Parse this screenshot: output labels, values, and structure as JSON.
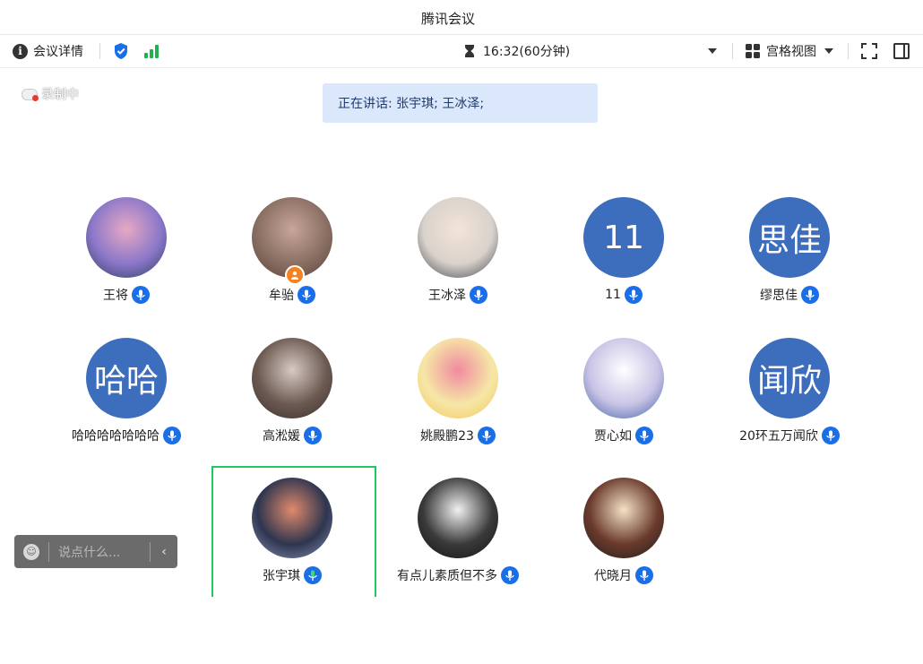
{
  "window": {
    "title": "腾讯会议"
  },
  "toolbar": {
    "details_label": "会议详情",
    "timer": "16:32(60分钟)",
    "view_label": "宫格视图"
  },
  "recording_label": "录制中",
  "speaking_banner": "正在讲话: 张宇琪; 王冰泽;",
  "participants": [
    {
      "name": "王将",
      "avatar_type": "photo",
      "avatar_colors": [
        "#8b77c9",
        "#e7a9c4",
        "#2b3a5e"
      ]
    },
    {
      "name": "牟骀",
      "avatar_type": "photo",
      "host": true,
      "avatar_colors": [
        "#8a6f63",
        "#c9a59a",
        "#5a4038"
      ]
    },
    {
      "name": "王冰泽",
      "avatar_type": "photo",
      "avatar_colors": [
        "#d9d2cc",
        "#f3e4d7",
        "#3b3f44"
      ]
    },
    {
      "name": "11",
      "avatar_type": "text",
      "avatar_text": "11"
    },
    {
      "name": "缪思佳",
      "avatar_type": "text",
      "avatar_text": "思佳"
    },
    {
      "name": "哈哈哈哈哈哈哈",
      "avatar_type": "text",
      "avatar_text": "哈哈"
    },
    {
      "name": "高淞媛",
      "avatar_type": "photo",
      "avatar_colors": [
        "#6b5a52",
        "#d7cbc3",
        "#3a2f2b"
      ]
    },
    {
      "name": "姚殿鹏23",
      "avatar_type": "photo",
      "avatar_colors": [
        "#f6e7a6",
        "#f08aa0",
        "#f3c65b"
      ]
    },
    {
      "name": "贾心如",
      "avatar_type": "photo",
      "avatar_colors": [
        "#c9c4e6",
        "#ffffff",
        "#3b5fa3"
      ]
    },
    {
      "name": "20环五万闻欣",
      "avatar_type": "text",
      "avatar_text": "闻欣"
    },
    {
      "name": "张宇琪",
      "avatar_type": "photo",
      "active": true,
      "avatar_colors": [
        "#2e3550",
        "#e08a6a",
        "#8b95b8"
      ]
    },
    {
      "name": "有点儿素质但不多",
      "avatar_type": "photo",
      "avatar_colors": [
        "#3a3a3a",
        "#f1f1f1",
        "#111111"
      ]
    },
    {
      "name": "代晓月",
      "avatar_type": "photo",
      "avatar_colors": [
        "#6a3a2c",
        "#f3e2c4",
        "#1d1d1d"
      ]
    }
  ],
  "chat": {
    "placeholder": "说点什么..."
  },
  "colors": {
    "accent": "#1a6ee8",
    "active_border": "#22c55e",
    "text_avatar_bg": "#3d6dbd",
    "banner_bg": "#dbe8fb"
  },
  "icons": [
    "info-icon",
    "shield-icon",
    "signal-icon",
    "hourglass-icon",
    "chevron-down-icon",
    "grid-view-icon",
    "fullscreen-icon",
    "sidebar-toggle-icon",
    "mic-icon",
    "host-icon",
    "emoji-icon",
    "collapse-icon",
    "record-icon"
  ]
}
